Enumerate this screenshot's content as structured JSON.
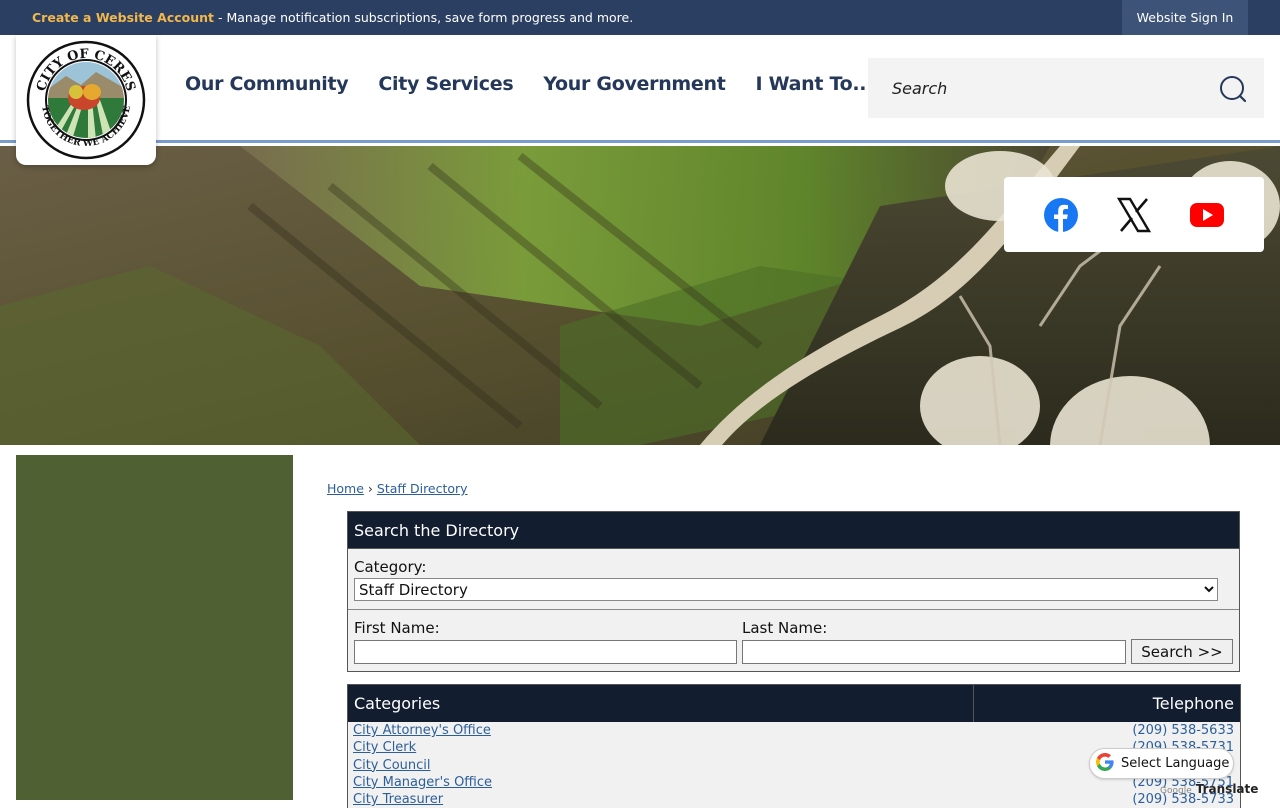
{
  "topbar": {
    "create_account_label": "Create a Website Account",
    "create_account_desc": " - Manage notification subscriptions, save form progress and more.",
    "sign_in_label": "Website Sign In"
  },
  "header": {
    "logo_alt": "City of Ceres - Together We Achieve",
    "logo_text_top": "CITY OF CERES",
    "logo_text_bottom": "TOGETHER WE ACHIEVE",
    "nav": [
      "Our Community",
      "City Services",
      "Your Government",
      "I Want To..."
    ],
    "search_placeholder": "Search"
  },
  "social": [
    "facebook-icon",
    "x-icon",
    "youtube-icon"
  ],
  "breadcrumb": {
    "home": "Home",
    "separator": "›",
    "current": "Staff Directory"
  },
  "directory_search": {
    "title": "Search the Directory",
    "category_label": "Category:",
    "category_value": "Staff Directory",
    "first_name_label": "First Name:",
    "last_name_label": "Last Name:",
    "search_button": "Search >>"
  },
  "categories": {
    "header_name": "Categories",
    "header_phone": "Telephone",
    "rows": [
      {
        "name": "City Attorney's Office",
        "phone": "(209) 538-5633"
      },
      {
        "name": "City Clerk",
        "phone": "(209) 538-5731"
      },
      {
        "name": "City Council",
        "phone": ""
      },
      {
        "name": "City Manager's Office",
        "phone": "(209) 538-5751"
      },
      {
        "name": "City Treasurer",
        "phone": "(209) 538-5733"
      }
    ]
  },
  "translate": {
    "label": "Select Language",
    "powered_prefix": "Google",
    "powered": "Translate"
  },
  "colors": {
    "topbar": "#2b3f63",
    "accent_gold": "#f2b84b",
    "nav_text": "#25385a",
    "sidebar": "#4f6133",
    "table_header": "#121d30",
    "link": "#2c5f9a"
  }
}
